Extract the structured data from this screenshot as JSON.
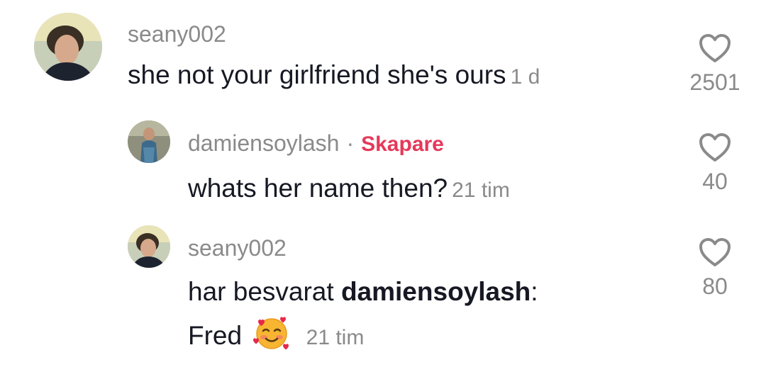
{
  "comments": [
    {
      "username": "seany002",
      "text": "she not your girlfriend she's ours",
      "time": "1 d",
      "likes": "2501",
      "avatar_icon": "user-avatar"
    },
    {
      "username": "damiensoylash",
      "separator": "·",
      "badge": "Skapare",
      "text": "whats her name then?",
      "time": "21 tim",
      "likes": "40",
      "avatar_icon": "user-avatar"
    },
    {
      "username": "seany002",
      "reply_prefix": "har besvarat",
      "reply_to": "damiensoylash",
      "reply_colon": ":",
      "text": "Fred",
      "emoji": "smiling-face-with-hearts",
      "time": "21 tim",
      "likes": "80",
      "avatar_icon": "user-avatar"
    }
  ],
  "colors": {
    "text": "#161823",
    "muted": "#8a8a8a",
    "creator_badge": "#e5395a",
    "background": "#ffffff"
  },
  "icons": {
    "like": "heart-outline-icon",
    "emoji": "smiling-face-with-hearts-icon"
  }
}
